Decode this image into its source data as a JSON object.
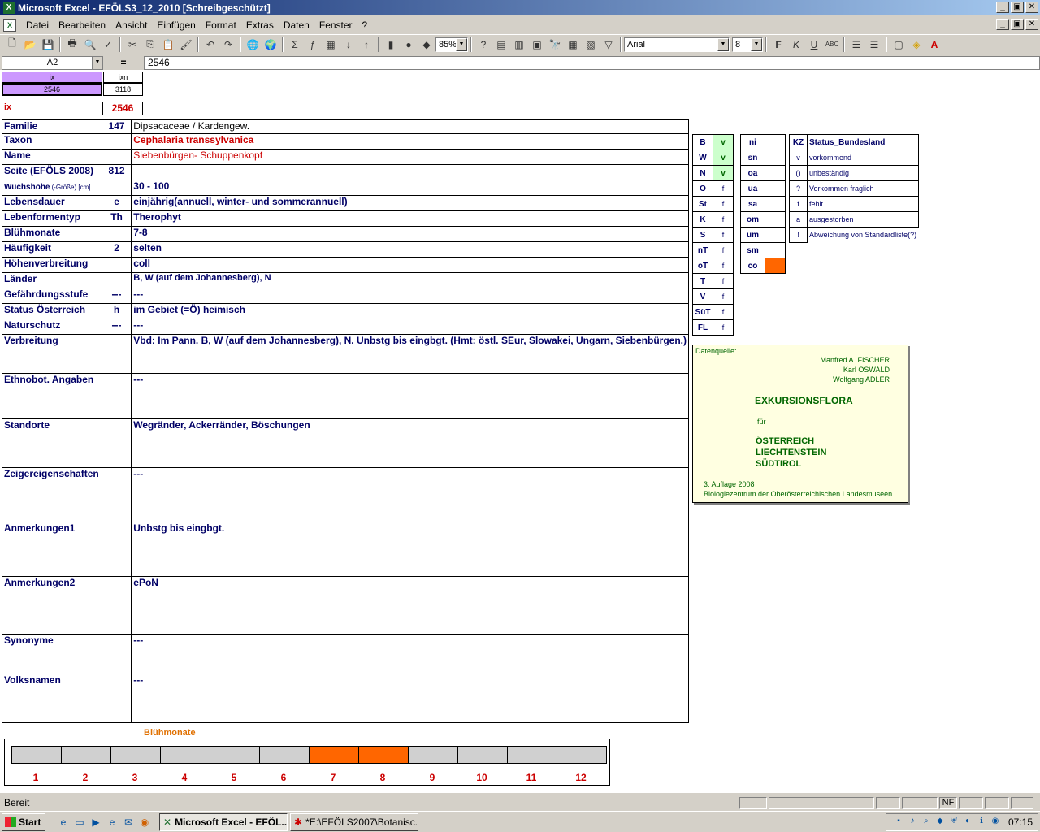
{
  "window": {
    "title": "Microsoft Excel - EFÖLS3_12_2010  [Schreibgeschützt]",
    "min": "_",
    "max": "▣",
    "close": "✕"
  },
  "menu": [
    "Datei",
    "Bearbeiten",
    "Ansicht",
    "Einfügen",
    "Format",
    "Extras",
    "Daten",
    "Fenster",
    "?"
  ],
  "toolbar": {
    "zoom": "85%",
    "font": "Arial",
    "size": "8"
  },
  "formula": {
    "namebox": "A2",
    "eq": "=",
    "value": "2546"
  },
  "top": {
    "ix_hdr": "ix",
    "ixn_hdr": "ixn",
    "ix_val": "2546",
    "ixn_val": "3118",
    "ix_label": "ix",
    "ix_big": "2546"
  },
  "rows": [
    {
      "label": "Familie",
      "code": "147",
      "value": "Dipsacaceae  /  Kardengew."
    },
    {
      "label": "Taxon",
      "code": "",
      "value": "Cephalaria transsylvanica"
    },
    {
      "label": "Name",
      "code": "",
      "value": "Siebenbürgen- Schuppenkopf"
    },
    {
      "label": "Seite (EFÖLS 2008)",
      "code": "812",
      "value": ""
    },
    {
      "label": "Wuchshöhe",
      "label_small": "(-Größe) [cm]",
      "code": "",
      "value": " 30 - 100"
    },
    {
      "label": "Lebensdauer",
      "code": "e",
      "value": "einjährig(annuell, winter- und sommerannuell)"
    },
    {
      "label": "Lebenformentyp",
      "code": "Th",
      "value": "Therophyt"
    },
    {
      "label": "Blühmonate",
      "code": "",
      "value": " 7-8"
    },
    {
      "label": "Häufigkeit",
      "code": "2",
      "value": "selten"
    },
    {
      "label": "Höhenverbreitung",
      "code": "",
      "value": "coll"
    },
    {
      "label": "Länder",
      "code": "",
      "value": " B, W (auf dem Johannesberg), N"
    },
    {
      "label": "Gefährdungsstufe",
      "code": "---",
      "value": "  ---"
    },
    {
      "label": "Status Österreich",
      "code": "h",
      "value": "im Gebiet (=Ö) heimisch"
    },
    {
      "label": "Naturschutz",
      "code": "---",
      "value": " ---"
    },
    {
      "label": "Verbreitung",
      "code": "",
      "value": "Vbd: Im Pann. B, W (auf dem Johannesberg), N. Unbstg bis eingbgt. (Hmt: östl. SEur, Slowakei, Ungarn, Siebenbürgen.)"
    },
    {
      "label": "Ethnobot. Angaben",
      "code": "",
      "value": "---"
    },
    {
      "label": "Standorte",
      "code": "",
      "value": "Wegränder, Ackerränder, Böschungen"
    },
    {
      "label": "Zeigereigenschaften",
      "code": "",
      "value": "---"
    },
    {
      "label": "Anmerkungen1",
      "code": "",
      "value": "Unbstg bis eingbgt."
    },
    {
      "label": "Anmerkungen2",
      "code": "",
      "value": "ePoN"
    },
    {
      "label": "Synonyme",
      "code": "",
      "value": "---"
    },
    {
      "label": "Volksnamen",
      "code": "",
      "value": "---"
    }
  ],
  "kz_left": [
    {
      "k": "B",
      "v": "v"
    },
    {
      "k": "W",
      "v": "v"
    },
    {
      "k": "N",
      "v": "v"
    },
    {
      "k": "O",
      "v": "f"
    },
    {
      "k": "St",
      "v": "f"
    },
    {
      "k": "K",
      "v": "f"
    },
    {
      "k": "S",
      "v": "f"
    },
    {
      "k": "nT",
      "v": "f"
    },
    {
      "k": "oT",
      "v": "f"
    },
    {
      "k": "T",
      "v": "f"
    },
    {
      "k": "V",
      "v": "f"
    },
    {
      "k": "SüT",
      "v": "f"
    },
    {
      "k": "FL",
      "v": "f"
    }
  ],
  "kz_mid": [
    {
      "k": "ni",
      "v": ""
    },
    {
      "k": "sn",
      "v": ""
    },
    {
      "k": "oa",
      "v": ""
    },
    {
      "k": "ua",
      "v": ""
    },
    {
      "k": "sa",
      "v": ""
    },
    {
      "k": "om",
      "v": ""
    },
    {
      "k": "um",
      "v": ""
    },
    {
      "k": "sm",
      "v": ""
    },
    {
      "k": "co",
      "v": ""
    }
  ],
  "status": {
    "hdr_k": "KZ",
    "hdr_t": "Status_Bundesland",
    "items": [
      {
        "k": "v",
        "t": "vorkommend"
      },
      {
        "k": "()",
        "t": "unbeständig"
      },
      {
        "k": "?",
        "t": "Vorkommen fraglich"
      },
      {
        "k": "f",
        "t": "fehlt"
      },
      {
        "k": "a",
        "t": "ausgestorben"
      },
      {
        "k": "!",
        "t": "Abweichung von Standardliste(?)"
      }
    ]
  },
  "source": {
    "label": "Datenquelle:",
    "author1": "Manfred A. FISCHER",
    "author2": "Karl OSWALD",
    "author3": "Wolfgang ADLER",
    "book": "EXKURSIONSFLORA",
    "fuer": "für",
    "c1": "ÖSTERREICH",
    "c2": "LIECHTENSTEIN",
    "c3": "SÜDTIROL",
    "edition": "3. Auflage 2008",
    "publisher": "Biologiezentrum der Oberösterreichischen Landesmuseen"
  },
  "bloom": {
    "title": "Blühmonate",
    "months": [
      "1",
      "2",
      "3",
      "4",
      "5",
      "6",
      "7",
      "8",
      "9",
      "10",
      "11",
      "12"
    ],
    "active": [
      7,
      8
    ],
    "color_active": "#ff6600",
    "color_inactive": "#d0d0d0"
  },
  "status_bar": {
    "text": "Bereit",
    "nf": "NF"
  },
  "taskbar": {
    "start": "Start",
    "task1": "Microsoft Excel - EFÖL...",
    "task2": "*E:\\EFÖLS2007\\Botanisc...",
    "clock": "07:15"
  }
}
